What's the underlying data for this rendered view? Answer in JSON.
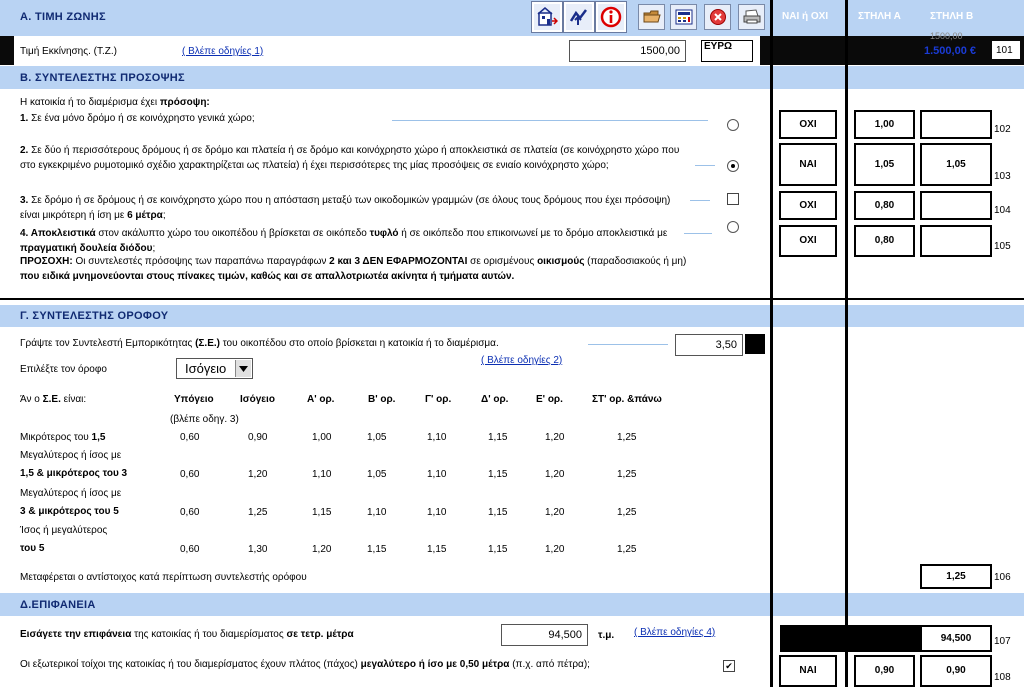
{
  "header": {
    "title": "Α. ΤΙΜΗ ΖΩΝΗΣ",
    "col_yesno": "ΝΑΙ ή ΟΧΙ",
    "col_a": "ΣΤΗΛΗ Α",
    "col_b": "ΣΤΗΛΗ Β",
    "toolbar_icons": [
      "building-icon",
      "chart-arrow-icon",
      "info-icon",
      "folder-icon",
      "calculator-icon",
      "close-icon",
      "print-icon"
    ]
  },
  "zone": {
    "label": "Τιμή Εκκίνησης. (Τ.Ζ.)",
    "link": "( Βλέπε οδηγίες 1)",
    "value": "1500,00",
    "unit": "ΕΥΡΩ",
    "col_b_value": "1.500,00 €",
    "col_b_overflow": "1500,00",
    "row_no": "101"
  },
  "facade": {
    "title": "Β. ΣΥΝΤΕΛΕΣΤΗΣ ΠΡΟΣΟΨΗΣ",
    "intro_a": "Η κατοικία ή το διαμέρισμα έχει ",
    "intro_b": "πρόσοψη:",
    "item1_num": "1.",
    "item1": "Σε ένα μόνο δρόμο ή σε κοινόχρηστο γενικά χώρο;",
    "item2_num": "2.",
    "item2": "Σε δύο ή περισσότερους δρόμους ή σε δρόμο και πλατεία ή σε δρόμο και κοινόχρηστο χώρο ή αποκλειστικά σε πλατεία (σε κοινόχρηστο χώρο που στο εγκεκριμένο ρυμοτομικό σχέδιο χαρακτηρίζεται ως πλατεία) ή έχει περισσότερες της μίας προσόψεις σε ενιαίο κοινόχρηστο χώρο;",
    "item3_num": "3.",
    "item3_a": "Σε δρόμο ή σε δρόμους ή σε κοινόχρηστο χώρο που η απόσταση μεταξύ των οικοδομικών γραμμών (σε όλους τους δρόμους που έχει πρόσοψη) είναι μικρότερη ή ίση με ",
    "item3_b": "6 μέτρα",
    "item3_c": ";",
    "item4_a": "4. Αποκλειστικά",
    "item4_b": " στον ακάλυπτο χώρο του οικοπέδου ή βρίσκεται σε οικόπεδο ",
    "item4_c": "τυφλό",
    "item4_d": " ή σε οικόπεδο που επικοινωνεί με το δρόμο αποκλειστικά με ",
    "item4_e": "πραγματική δουλεία διόδου",
    "item4_f": ";",
    "note_a": "ΠΡΟΣΟΧΗ:",
    "note_b": " Οι συντελεστές πρόσοψης των παραπάνω παραγράφων ",
    "note_c": "2 και 3 ΔΕΝ ΕΦΑΡΜΟΖΟΝΤΑΙ",
    "note_d": " σε ορισμένους ",
    "note_e": "οικισμούς",
    "note_f": " (παραδοσιακούς ή μη) ",
    "note_g": "που ειδικά μνημονεύονται στους πίνακες τιμών, καθώς και σε απαλλοτριωτέα ακίνητα ή τμήματα αυτών.",
    "rows": [
      {
        "yesno": "ΟΧΙ",
        "a": "1,00",
        "b": "",
        "no": "102"
      },
      {
        "yesno": "ΝΑΙ",
        "a": "1,05",
        "b": "1,05",
        "no": "103"
      },
      {
        "yesno": "ΟΧΙ",
        "a": "0,80",
        "b": "",
        "no": "104"
      },
      {
        "yesno": "ΟΧΙ",
        "a": "0,80",
        "b": "",
        "no": "105"
      }
    ]
  },
  "floor": {
    "title": "Γ. ΣΥΝΤΕΛΕΣΤΗΣ ΟΡΟΦΟΥ",
    "se_a": "Γράψτε τον Συντελεστή Εμπορικότητας ",
    "se_b": "(Σ.Ε.)",
    "se_c": " του οικοπέδου στο οποίο βρίσκεται η κατοικία ή το διαμέρισμα.",
    "se_value": "3,50",
    "link": "( Βλέπε οδηγίες 2)",
    "select_label": "Επιλέξτε τον όροφο",
    "select_value": "Ισόγειο",
    "table_caption_a": "Άν ο ",
    "table_caption_b": "Σ.Ε.",
    "table_caption_c": " είναι:",
    "columns": [
      "Υπόγειο",
      "Ισόγειο",
      "Α' ορ.",
      "Β' ορ.",
      "Γ' ορ.",
      "Δ' ορ.",
      "Ε' ορ.",
      "ΣΤ' ορ. &πάνω"
    ],
    "basement_note": "(βλέπε οδηγ. 3)",
    "rows": [
      {
        "l1": "Μικρότερος του ",
        "l1b": "1,5",
        "l2": "",
        "vals": [
          "0,60",
          "0,90",
          "1,00",
          "1,05",
          "1,10",
          "1,15",
          "1,20",
          "1,25"
        ]
      },
      {
        "l1": "Μεγαλύτερος ή ίσος με",
        "l1b": "",
        "l2": "1,5 & μικρότερος του 3",
        "vals": [
          "0,60",
          "1,20",
          "1,10",
          "1,05",
          "1,10",
          "1,15",
          "1,20",
          "1,25"
        ]
      },
      {
        "l1": "Μεγαλύτερος ή ίσος με",
        "l1b": "",
        "l2": "3 & μικρότερος του 5",
        "vals": [
          "0,60",
          "1,25",
          "1,15",
          "1,10",
          "1,10",
          "1,15",
          "1,20",
          "1,25"
        ]
      },
      {
        "l1": "Ίσος ή μεγαλύτερος",
        "l1b": "",
        "l2": "του 5",
        "vals": [
          "0,60",
          "1,30",
          "1,20",
          "1,15",
          "1,15",
          "1,15",
          "1,20",
          "1,25"
        ]
      }
    ],
    "transfer": "Μεταφέρεται ο αντίστοιχος κατά περίπτωση συντελεστής ορόφου",
    "col_b_value": "1,25",
    "row_no": "106"
  },
  "surface": {
    "title": "Δ.ΕΠΙΦΑΝΕΙΑ",
    "enter_a": "Εισάγετε την επιφάνεια",
    "enter_b": " της κατοικίας ή του διαμερίσματος ",
    "enter_c": "σε τετρ. μέτρα",
    "value": "94,500",
    "unit": "τ.μ.",
    "link": "( Βλέπε οδηγίες 4)",
    "col_b_value": "94,500",
    "row_no": "107",
    "wall_a": "Οι εξωτερικοί τοίχοι της κατοικίας ή του διαμερίσματος έχουν πλάτος (πάχος) ",
    "wall_b": "μεγαλύτερο ή ίσο με 0,50 μέτρα",
    "wall_c": " (π.χ. από πέτρα);",
    "wall_yesno": "ΝΑΙ",
    "wall_a_value": "0,90",
    "wall_b_value": "0,90",
    "wall_row_no": "108"
  }
}
